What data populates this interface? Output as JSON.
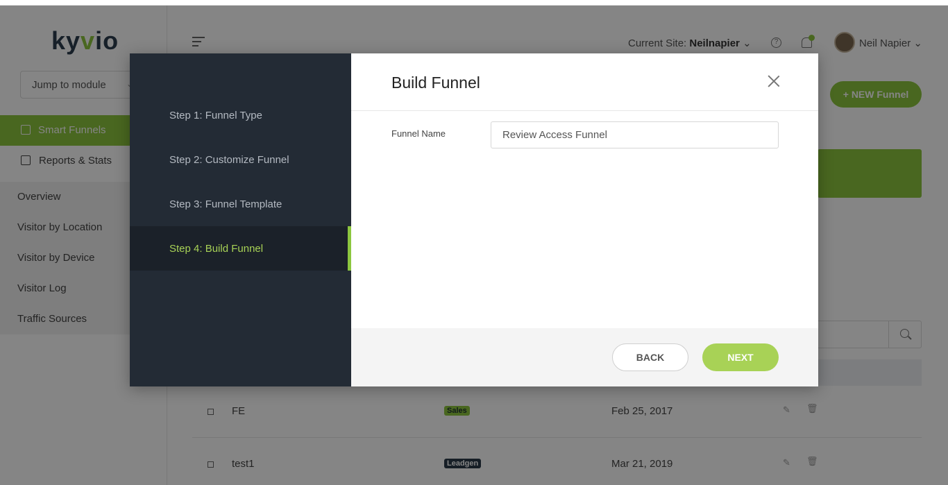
{
  "logo": {
    "pre": "ky",
    "v": "v",
    "post": "io"
  },
  "sidebar": {
    "jump_label": "Jump to module",
    "items": [
      {
        "label": "Smart Funnels"
      },
      {
        "label": "Reports & Stats"
      },
      {
        "label": "Overview"
      },
      {
        "label": "Visitor by Location"
      },
      {
        "label": "Visitor by Device"
      },
      {
        "label": "Visitor Log"
      },
      {
        "label": "Traffic Sources"
      }
    ]
  },
  "header": {
    "current_site_label": "Current Site:",
    "current_site_value": "Neilnapier",
    "user_name": "Neil Napier",
    "help_icon": "?"
  },
  "page": {
    "new_funnel_label": "+ NEW Funnel",
    "rows": [
      {
        "name": "FE",
        "tag": "Sales",
        "date": "Feb 25, 2017"
      },
      {
        "name": "test1",
        "tag": "Leadgen",
        "date": "Mar 21, 2019"
      }
    ]
  },
  "modal": {
    "title": "Build Funnel",
    "steps": [
      {
        "label": "Step 1: Funnel Type"
      },
      {
        "label": "Step 2: Customize Funnel"
      },
      {
        "label": "Step 3: Funnel Template"
      },
      {
        "label": "Step 4: Build Funnel"
      }
    ],
    "field_label": "Funnel Name",
    "field_value": "Review Access Funnel",
    "back_label": "BACK",
    "next_label": "NEXT"
  },
  "colors": {
    "accent": "#8cc63f",
    "dark": "#232b35"
  }
}
